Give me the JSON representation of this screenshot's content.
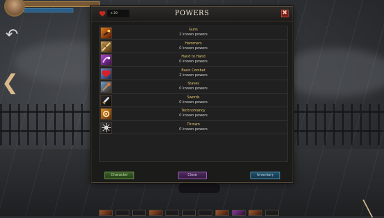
{
  "dialog": {
    "title": "POWERS",
    "gold_amount": "x 20",
    "close_symbol": "✖"
  },
  "powers": [
    {
      "name": "Guns",
      "count_text": "2 known powers",
      "icon": "gun-fire-icon"
    },
    {
      "name": "Hammers",
      "count_text": "0 known powers",
      "icon": "hammer-slash-icon"
    },
    {
      "name": "Hand to Hand",
      "count_text": "0 known powers",
      "icon": "fist-icon"
    },
    {
      "name": "Basic Combat",
      "count_text": "2 known powers",
      "icon": "heart-icon"
    },
    {
      "name": "Staves",
      "count_text": "0 known powers",
      "icon": "staff-icon"
    },
    {
      "name": "Swords",
      "count_text": "0 known powers",
      "icon": "sword-icon"
    },
    {
      "name": "Technomancy",
      "count_text": "0 known powers",
      "icon": "tech-gear-icon"
    },
    {
      "name": "Thrown",
      "count_text": "0 known powers",
      "icon": "spiked-orb-icon"
    }
  ],
  "buttons": {
    "character": "Character",
    "close": "Close",
    "inventory": "Inventory"
  },
  "colors": {
    "power_name": "#e8c972",
    "character_button": "#3b5f2a",
    "close_button": "#4e2a5e",
    "inventory_button": "#23506a"
  }
}
